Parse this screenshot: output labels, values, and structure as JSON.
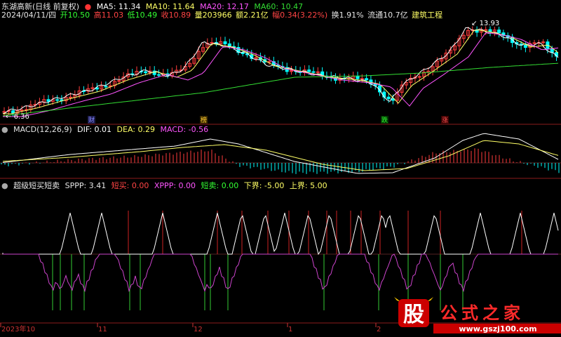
{
  "header1": {
    "name": "东湖高新(日线 前复权)",
    "ma5": "MA5: 11.34",
    "ma10": "MA10: 11.64",
    "ma20": "MA20: 12.17",
    "ma60": "MA60: 10.47"
  },
  "header2": {
    "date": "2024/04/11/四",
    "open": "开10.50",
    "high": "高11.03",
    "low": "低10.49",
    "close": "收10.89",
    "volume": "量203966",
    "amount": "额2.21亿",
    "change": "幅0.34(3.22%)",
    "turnover": "换1.91%",
    "float": "流通10.7亿",
    "industry": "建筑工程"
  },
  "price_markers": {
    "high": "13.93",
    "low": "6.36"
  },
  "event_tags": [
    "财",
    "榜",
    "跌",
    "涨"
  ],
  "macd_header": {
    "name": "MACD(12,26,9)",
    "dif": "DIF: 0.01",
    "dea": "DEA: 0.29",
    "macd": "MACD: -0.56"
  },
  "indicator_header": {
    "name": "超级短买短卖",
    "sppp": "SPPP: 3.41",
    "short_buy": "短买: 0.00",
    "xppp": "XPPP: 0.00",
    "short_sell": "短卖: 0.00",
    "lower": "下界: -5.00",
    "upper": "上界: 5.00"
  },
  "time_axis": [
    "2023年10",
    "11",
    "12",
    "1",
    "2"
  ],
  "watermark": {
    "logo": "股",
    "title": "公式之家",
    "url": "www.gszj100.com"
  },
  "colors": {
    "up": "#ff3c3c",
    "down": "#00ffff",
    "ma5": "#ffffff",
    "ma10": "#ffff66",
    "ma20": "#ff55ff",
    "ma60": "#33dd33",
    "grid": "#8b1c1c"
  }
}
